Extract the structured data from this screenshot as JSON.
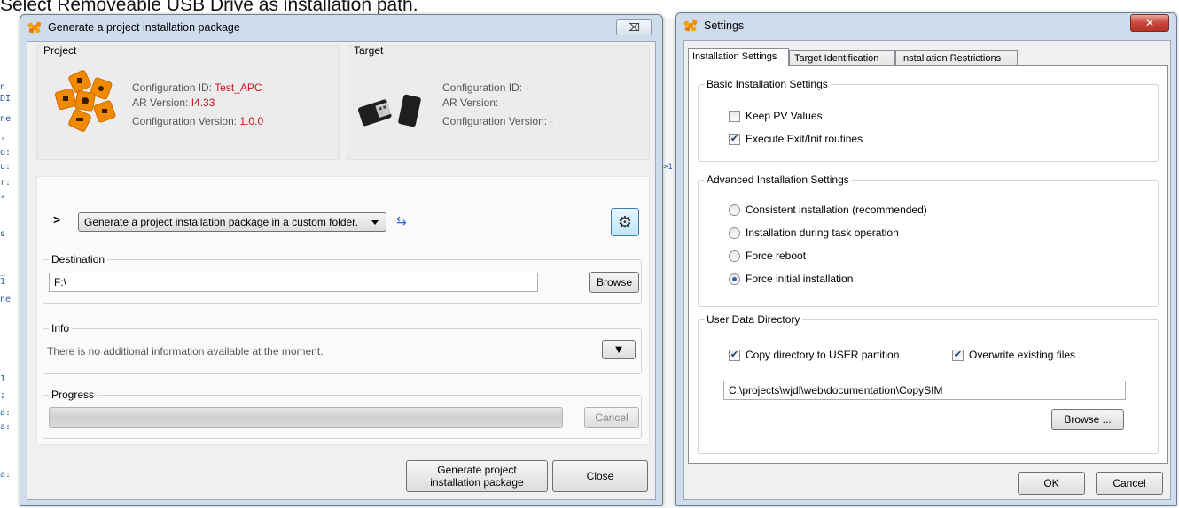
{
  "background": {
    "banner_text": "Select Removeable USB Drive as installation path.",
    "code_chars": [
      "n",
      "DI",
      "ne",
      "'",
      "o:",
      "u:",
      "r:",
      "*",
      "s",
      "_",
      "1",
      "ne",
      "_",
      "1",
      ";",
      "a:",
      "a:",
      "a:"
    ],
    "mid_text": ">1"
  },
  "generate_window": {
    "title": "Generate a project installation package",
    "close_glyph": "⌧",
    "project": {
      "legend": "Project",
      "config_id_label": "Configuration ID:",
      "config_id_value": "Test_APC",
      "ar_version_label": "AR Version:",
      "ar_version_value": "I4.33",
      "config_version_label": "Configuration Version:",
      "config_version_value": "1.0.0"
    },
    "target": {
      "legend": "Target",
      "config_id_label": "Configuration ID:",
      "config_id_value": "-",
      "ar_version_label": "AR Version:",
      "ar_version_value": "-",
      "config_version_label": "Configuration Version:",
      "config_version_value": "-"
    },
    "expand_glyph": ">",
    "mode_select": "Generate a project installation package in a custom folder.",
    "refresh_glyph": "⇆",
    "settings_glyph": "⚙",
    "destination": {
      "legend": "Destination",
      "value": "F:\\",
      "browse_label": "Browse"
    },
    "info": {
      "legend": "Info",
      "text": "There is no additional information available at the moment.",
      "toggle_glyph": "▼"
    },
    "progress": {
      "legend": "Progress",
      "value": 0,
      "cancel_label": "Cancel"
    },
    "generate_label": "Generate project\ninstallation package",
    "close_label": "Close"
  },
  "settings_window": {
    "title": "Settings",
    "close_glyph": "✕",
    "tabs": [
      "Installation Settings",
      "Target Identification",
      "Installation Restrictions"
    ],
    "active_tab": 0,
    "basic": {
      "legend": "Basic Installation Settings",
      "keep_pv": {
        "label": "Keep PV Values",
        "checked": false
      },
      "exec_exit": {
        "label": "Execute Exit/Init routines",
        "checked": true
      }
    },
    "advanced": {
      "legend": "Advanced Installation Settings",
      "options": [
        {
          "label": "Consistent installation (recommended)",
          "selected": false
        },
        {
          "label": "Installation during task operation",
          "selected": false
        },
        {
          "label": "Force reboot",
          "selected": false
        },
        {
          "label": "Force initial installation",
          "selected": true
        }
      ]
    },
    "user_data": {
      "legend": "User Data Directory",
      "copy_dir": {
        "label": "Copy directory to USER partition",
        "checked": true
      },
      "overwrite": {
        "label": "Overwrite existing files",
        "checked": true
      },
      "path": "C:\\projects\\wjdl\\web\\documentation\\CopySIM",
      "browse_label": "Browse ..."
    },
    "ok_label": "OK",
    "cancel_label": "Cancel"
  },
  "colors": {
    "title_close_red": "#c8463c",
    "value_red": "#c8141e",
    "logo_orange": "#f08a00"
  }
}
